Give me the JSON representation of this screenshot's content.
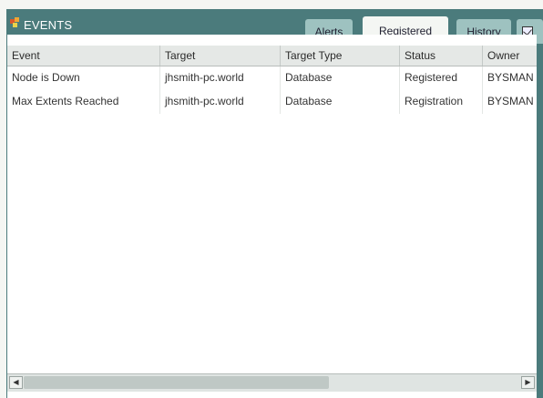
{
  "window": {
    "title": "EVENTS"
  },
  "tabs": [
    {
      "label": "Alerts",
      "active": false
    },
    {
      "label": "Registered",
      "active": true
    },
    {
      "label": "History",
      "active": false
    }
  ],
  "table": {
    "columns": [
      "Event",
      "Target",
      "Target Type",
      "Status",
      "Owner"
    ],
    "rows": [
      [
        "Node is Down",
        "jhsmith-pc.world",
        "Database",
        "Registered",
        "BYSMAN"
      ],
      [
        "Max Extents Reached",
        "jhsmith-pc.world",
        "Database",
        "Registration",
        "BYSMAN"
      ]
    ]
  },
  "icons": {
    "app": "events-flag-icon",
    "tab_extra": "checkbox-icon",
    "scroll_left": "arrow-left-icon",
    "scroll_right": "arrow-right-icon"
  },
  "colors": {
    "frame": "#4b7b7c",
    "tab_inactive": "#9ec2c0",
    "tab_active": "#f4f6f3",
    "content_bg": "#ffffff"
  }
}
